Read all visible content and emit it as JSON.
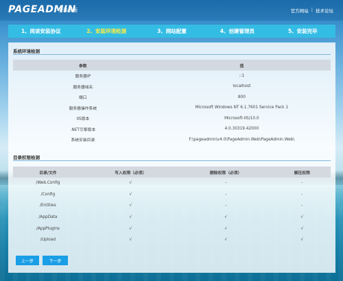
{
  "header": {
    "logo": "PAGEADMIN",
    "subtitle": "安装界面",
    "links": [
      "官方网站",
      "技术论坛"
    ],
    "link_separator": "|"
  },
  "steps": [
    {
      "label": "1、阅读安装协议",
      "state": "done"
    },
    {
      "label": "2、安装环境检测",
      "state": "active"
    },
    {
      "label": "3、网站配置",
      "state": "todo"
    },
    {
      "label": "4、创建管理员",
      "state": "todo"
    },
    {
      "label": "5、安装完毕",
      "state": "todo"
    }
  ],
  "env": {
    "title": "系统环境检测",
    "headers": [
      "参数",
      "值"
    ],
    "rows": [
      [
        "服务器IP",
        "::1"
      ],
      [
        "服务器域名",
        "localhost"
      ],
      [
        "端口",
        "800"
      ],
      [
        "服务器操作系统",
        "Microsoft Windows NT 6.1.7601 Service Pack 1"
      ],
      [
        "IIS版本",
        "Microsoft-IIS/10.0"
      ],
      [
        ".NET引擎版本",
        "4.0.30319.42000"
      ],
      [
        "系统安装目录",
        "F:\\pageadmin\\v4.0\\PageAdmin.Web\\PageAdmin.Web\\"
      ]
    ]
  },
  "perm": {
    "title": "目录权限检测",
    "headers": [
      "目录/文件",
      "写入权限（必须）",
      "删除权限（必须）",
      "解压权限"
    ],
    "rows": [
      [
        "/Web.Config",
        "√",
        "-",
        "-"
      ],
      [
        "/Config",
        "√",
        "-",
        "-"
      ],
      [
        "/Entities",
        "√",
        "-",
        "-"
      ],
      [
        "/AppData",
        "√",
        "√",
        "√"
      ],
      [
        "/AppPlugins",
        "√",
        "√",
        "√"
      ],
      [
        "/Upload",
        "√",
        "√",
        "√"
      ]
    ]
  },
  "buttons": {
    "prev": "上一步",
    "next": "下一步"
  },
  "colors": {
    "step_bar": "#34bde4",
    "step_active_text": "#ffee45",
    "button": "#1a9ee6",
    "section_line": "#7fb6dc"
  }
}
